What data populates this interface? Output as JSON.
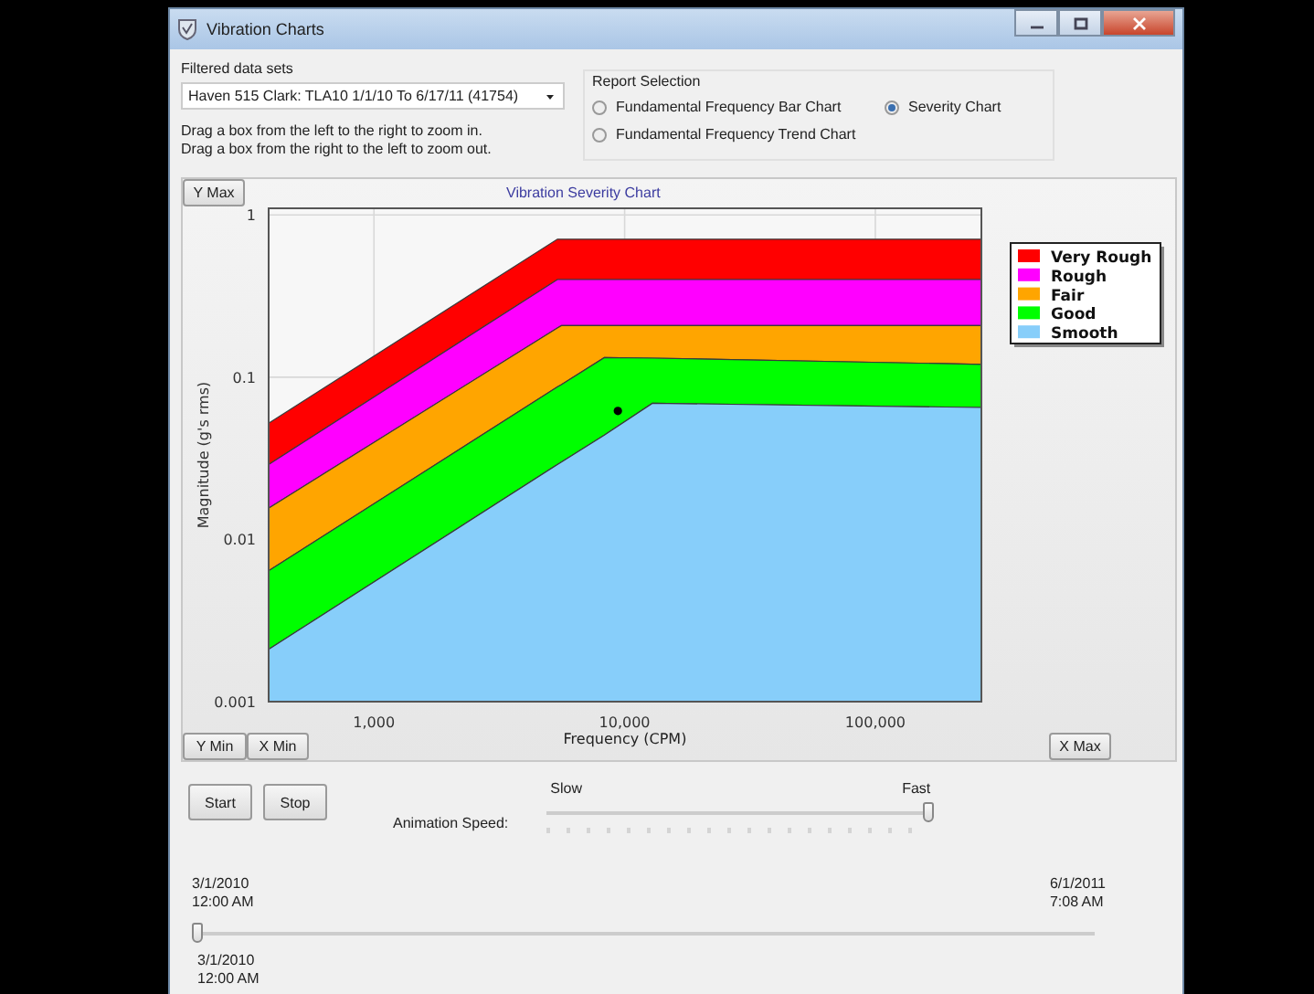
{
  "window": {
    "title": "Vibration Charts"
  },
  "filter": {
    "label": "Filtered data sets",
    "value": "Haven 515 Clark: TLA10 1/1/10 To 6/17/11 (41754)"
  },
  "hints": [
    "Drag a box from the left to the right to zoom in.",
    "Drag a box from the right to the left to zoom out."
  ],
  "report_selection": {
    "label": "Report Selection",
    "options": [
      {
        "label": "Fundamental Frequency Bar Chart",
        "selected": false
      },
      {
        "label": "Severity Chart",
        "selected": true
      },
      {
        "label": "Fundamental Frequency Trend Chart",
        "selected": false
      }
    ]
  },
  "chart": {
    "buttons": {
      "y_max": "Y Max",
      "y_min": "Y Min",
      "x_min": "X Min",
      "x_max": "X Max"
    },
    "title": "Vibration Severity Chart",
    "xlabel": "Frequency (CPM)",
    "ylabel": "Magnitude (g's rms)",
    "x_tick_labels": [
      "1,000",
      "10,000",
      "100,000"
    ],
    "y_tick_labels": [
      "1",
      "0.1",
      "0.01",
      "0.001"
    ],
    "legend": [
      {
        "name": "Very Rough",
        "color": "#ff0000"
      },
      {
        "name": "Rough",
        "color": "#ff00ff"
      },
      {
        "name": "Fair",
        "color": "#ffa500"
      },
      {
        "name": "Good",
        "color": "#00ff00"
      },
      {
        "name": "Smooth",
        "color": "#87cefa"
      }
    ]
  },
  "animation": {
    "buttons": [
      "Start",
      "Stop"
    ],
    "label": "Animation Speed:",
    "min_label": "Slow",
    "max_label": "Fast",
    "level": 1
  },
  "timeline": {
    "start": [
      "3/1/2010",
      "12:00 AM"
    ],
    "end": [
      "6/1/2011",
      "7:08 AM"
    ],
    "current": [
      "3/1/2010",
      "12:00 AM"
    ],
    "level": 0
  }
}
